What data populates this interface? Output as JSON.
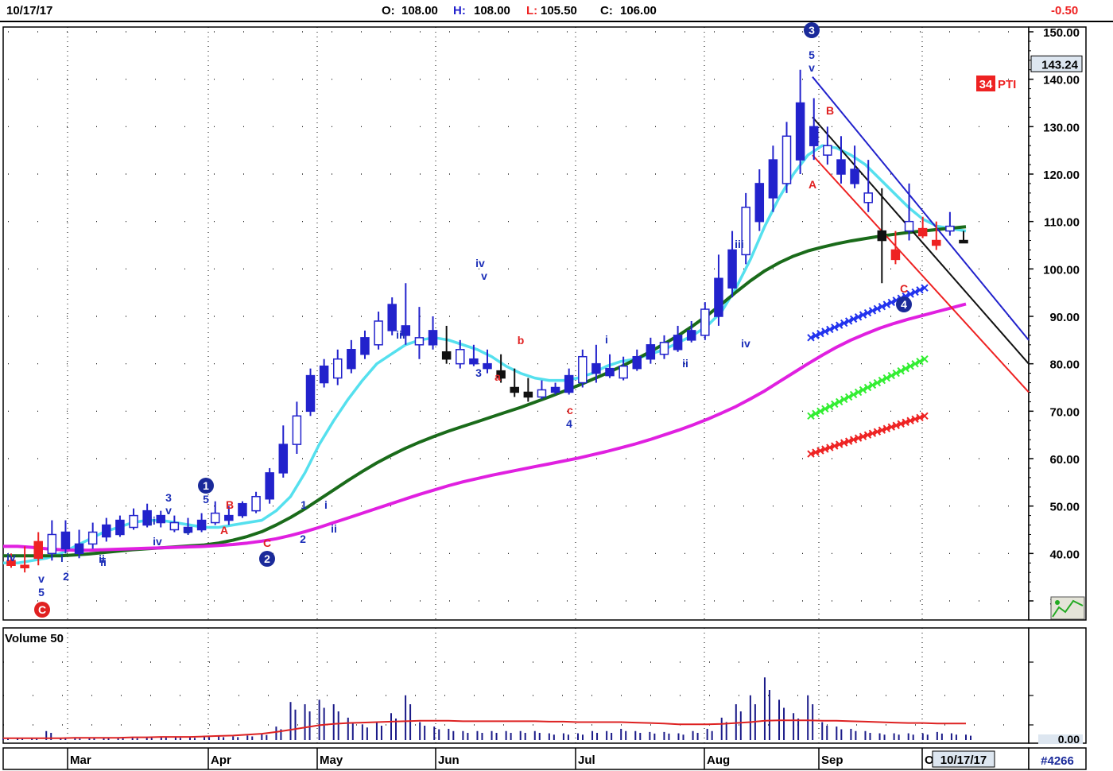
{
  "header": {
    "date": "10/17/17",
    "open_label": "O:",
    "open": "108.00",
    "high_label": "H:",
    "high": "108.00",
    "low_label": "L:",
    "low": "105.50",
    "close_label": "C:",
    "close": "106.00",
    "change": "-0.50"
  },
  "price_panel": {
    "current_price": "143.24",
    "indicator_value": "34",
    "indicator_name": "PTI",
    "icon": "chart-config-icon"
  },
  "volume_panel": {
    "label": "Volume 50",
    "axis_value": "0.00"
  },
  "footer": {
    "cursor_date": "10/17/17",
    "chart_id": "#4266"
  },
  "colors": {
    "candle_up": "#2222cc",
    "candle_down": "#111111",
    "candle_red": "#ee2222",
    "ma_cyan": "#55e0ee",
    "ma_green": "#1a6b1a",
    "ma_magenta": "#e020e0",
    "volume_bar": "#1a1a88",
    "volume_avg": "#dd2222",
    "wave_blue": "#1c2fb8",
    "wave_red": "#e02020"
  },
  "chart_data": {
    "type": "candlestick",
    "y_axis": {
      "min": 30,
      "max": 150,
      "ticks": [
        "150.00",
        "140.00",
        "130.00",
        "120.00",
        "110.00",
        "100.00",
        "90.00",
        "80.00",
        "70.00",
        "60.00",
        "50.00",
        "40.00",
        "30.00"
      ]
    },
    "months": [
      "Mar",
      "Apr",
      "May",
      "Jun",
      "Jul",
      "Aug",
      "Sep",
      "O"
    ],
    "candles": [
      [
        40.0,
        38.5,
        37.5,
        37.0,
        "r"
      ],
      [
        41.5,
        37.0,
        37.5,
        36.0,
        "r"
      ],
      [
        44.5,
        39.0,
        42.5,
        37.5,
        "r"
      ],
      [
        47.0,
        40.0,
        44.0,
        38.5,
        "u"
      ],
      [
        47.0,
        41.0,
        44.5,
        40.0,
        "u"
      ],
      [
        45.0,
        40.0,
        42.0,
        39.0,
        "u"
      ],
      [
        46.5,
        42.0,
        44.5,
        41.0,
        "u"
      ],
      [
        47.5,
        43.5,
        46.0,
        42.5,
        "u"
      ],
      [
        48.0,
        44.0,
        47.0,
        43.5,
        "u"
      ],
      [
        49.5,
        45.5,
        48.0,
        45.0,
        "u"
      ],
      [
        50.5,
        46.0,
        49.0,
        45.5,
        "u"
      ],
      [
        49.0,
        46.5,
        48.0,
        45.5,
        "u"
      ],
      [
        48.0,
        45.0,
        46.5,
        44.5,
        "u"
      ],
      [
        47.5,
        44.5,
        45.5,
        44.0,
        "u"
      ],
      [
        48.5,
        45.0,
        47.0,
        44.5,
        "u"
      ],
      [
        51.0,
        46.5,
        48.5,
        46.0,
        "u"
      ],
      [
        50.0,
        47.0,
        48.0,
        46.0,
        "u"
      ],
      [
        51.0,
        48.0,
        50.5,
        47.5,
        "u"
      ],
      [
        53.0,
        49.0,
        52.0,
        48.5,
        "u"
      ],
      [
        58.0,
        51.5,
        57.0,
        50.5,
        "u"
      ],
      [
        67.0,
        57.0,
        63.0,
        56.0,
        "u"
      ],
      [
        72.0,
        63.0,
        69.0,
        61.0,
        "u"
      ],
      [
        79.0,
        70.0,
        77.5,
        69.0,
        "u"
      ],
      [
        81.0,
        76.0,
        79.5,
        75.0,
        "u"
      ],
      [
        83.0,
        77.0,
        81.0,
        75.5,
        "u"
      ],
      [
        85.0,
        79.0,
        83.0,
        78.0,
        "u"
      ],
      [
        87.0,
        82.0,
        85.5,
        81.0,
        "u"
      ],
      [
        91.0,
        84.0,
        89.0,
        83.0,
        "u"
      ],
      [
        94.0,
        87.0,
        92.5,
        86.0,
        "u"
      ],
      [
        97.0,
        86.0,
        88.0,
        84.0,
        "u"
      ],
      [
        92.0,
        84.0,
        85.5,
        81.0,
        "u"
      ],
      [
        90.0,
        84.0,
        87.0,
        83.0,
        "u"
      ],
      [
        88.0,
        81.0,
        82.5,
        80.0,
        "d"
      ],
      [
        85.0,
        80.0,
        83.0,
        79.0,
        "u"
      ],
      [
        84.0,
        80.0,
        81.0,
        79.5,
        "u"
      ],
      [
        83.0,
        79.0,
        80.0,
        78.0,
        "u"
      ],
      [
        82.0,
        77.0,
        78.5,
        76.0,
        "d"
      ],
      [
        79.0,
        74.0,
        75.0,
        73.0,
        "d"
      ],
      [
        77.0,
        73.0,
        74.0,
        72.0,
        "d"
      ],
      [
        76.5,
        73.0,
        74.5,
        72.5,
        "u"
      ],
      [
        76.0,
        74.0,
        75.0,
        73.5,
        "u"
      ],
      [
        79.0,
        74.0,
        77.5,
        73.5,
        "u"
      ],
      [
        83.0,
        76.0,
        81.5,
        75.0,
        "u"
      ],
      [
        84.0,
        78.0,
        80.0,
        76.0,
        "u"
      ],
      [
        82.0,
        77.5,
        79.0,
        77.0,
        "u"
      ],
      [
        81.5,
        77.0,
        79.5,
        76.5,
        "u"
      ],
      [
        83.0,
        79.0,
        81.5,
        78.5,
        "u"
      ],
      [
        85.5,
        81.0,
        84.0,
        80.0,
        "u"
      ],
      [
        86.0,
        82.0,
        84.5,
        81.0,
        "u"
      ],
      [
        88.0,
        83.0,
        86.0,
        82.5,
        "u"
      ],
      [
        89.0,
        85.0,
        87.0,
        84.5,
        "u"
      ],
      [
        93.0,
        86.0,
        91.5,
        85.0,
        "u"
      ],
      [
        103.0,
        90.0,
        98.0,
        88.0,
        "u"
      ],
      [
        108.0,
        96.0,
        104.0,
        94.0,
        "u"
      ],
      [
        116.0,
        103.0,
        113.0,
        101.0,
        "u"
      ],
      [
        121.0,
        110.0,
        118.0,
        108.0,
        "u"
      ],
      [
        126.0,
        115.0,
        123.0,
        112.0,
        "u"
      ],
      [
        131.0,
        118.0,
        128.0,
        116.0,
        "u"
      ],
      [
        142.0,
        123.0,
        135.0,
        120.0,
        "u"
      ],
      [
        136.0,
        126.0,
        130.0,
        123.0,
        "u"
      ],
      [
        130.0,
        124.0,
        126.0,
        122.0,
        "u"
      ],
      [
        128.0,
        120.0,
        123.0,
        118.0,
        "u"
      ],
      [
        126.0,
        118.0,
        121.0,
        117.0,
        "u"
      ],
      [
        123.0,
        114.0,
        116.0,
        112.0,
        "u"
      ],
      [
        117.0,
        106.0,
        108.0,
        97.0,
        "d"
      ],
      [
        108.0,
        102.0,
        104.0,
        101.0,
        "r"
      ],
      [
        118.0,
        108.0,
        110.0,
        106.0,
        "u"
      ],
      [
        111.0,
        107.0,
        108.5,
        106.5,
        "r"
      ],
      [
        110.0,
        105.0,
        106.0,
        104.0,
        "r"
      ],
      [
        112.0,
        108.0,
        109.0,
        107.0,
        "u"
      ],
      [
        108.0,
        105.5,
        106.0,
        105.5,
        "d"
      ]
    ],
    "moving_averages": [
      {
        "name": "ma-cyan",
        "values": [
          38,
          38,
          38.5,
          39,
          40,
          41.5,
          43,
          44.5,
          45.5,
          46.5,
          47,
          47,
          46.5,
          46,
          45.5,
          45.5,
          46,
          46.5,
          47,
          49,
          52,
          57,
          63,
          68,
          72.5,
          76.5,
          80,
          82,
          84,
          85,
          85.5,
          85,
          84,
          83,
          81.5,
          79.5,
          78,
          77,
          76.5,
          76.5,
          77,
          78,
          79.5,
          80.5,
          81,
          82,
          83,
          84.5,
          86,
          88,
          91,
          96,
          102,
          109,
          115,
          120,
          124,
          126,
          125.5,
          124,
          122,
          119,
          116,
          113,
          110.5,
          109,
          108.5,
          108
        ]
      },
      {
        "name": "ma-green",
        "values": [
          39.5,
          39.5,
          39.5,
          39.5,
          39.5,
          39.7,
          39.9,
          40.2,
          40.5,
          40.8,
          41,
          41.2,
          41.4,
          41.6,
          41.8,
          42.2,
          42.8,
          43.6,
          44.6,
          46,
          47.6,
          49.4,
          51.4,
          53.4,
          55.4,
          57.3,
          59.1,
          60.7,
          62.2,
          63.5,
          64.7,
          65.8,
          66.8,
          67.8,
          68.8,
          69.8,
          70.8,
          71.9,
          73,
          74.2,
          75.4,
          76.7,
          78,
          79.4,
          80.9,
          82.5,
          84.2,
          86,
          88,
          90.2,
          92.6,
          95.1,
          97.5,
          99.6,
          101.3,
          102.7,
          103.8,
          104.6,
          105.3,
          105.9,
          106.4,
          106.9,
          107.3,
          107.7,
          108,
          108.3,
          108.6,
          108.9
        ]
      },
      {
        "name": "ma-magenta",
        "values": [
          41.5,
          41.5,
          41.3,
          41,
          40.8,
          40.7,
          40.7,
          40.8,
          40.9,
          41,
          41.1,
          41.2,
          41.3,
          41.4,
          41.5,
          41.7,
          41.9,
          42.2,
          42.6,
          43.1,
          43.8,
          44.6,
          45.5,
          46.5,
          47.5,
          48.5,
          49.5,
          50.5,
          51.5,
          52.5,
          53.4,
          54.3,
          55.1,
          55.8,
          56.5,
          57.1,
          57.7,
          58.3,
          58.9,
          59.5,
          60.1,
          60.8,
          61.5,
          62.3,
          63.1,
          64,
          65,
          66,
          67.1,
          68.3,
          69.6,
          71,
          72.6,
          74.3,
          76.2,
          78.1,
          80,
          81.8,
          83.5,
          85,
          86.3,
          87.5,
          88.5,
          89.4,
          90.2,
          91,
          91.8,
          92.6
        ]
      }
    ],
    "channel_lines": [
      {
        "name": "upper-channel",
        "color": "#2222cc",
        "from": [
          140.5,
          "Aug-end"
        ],
        "to": [
          85,
          "right-edge"
        ]
      },
      {
        "name": "mid-channel",
        "color": "#111111",
        "from": [
          132,
          "Aug-end"
        ],
        "to": [
          80,
          "right-edge"
        ]
      },
      {
        "name": "lower-channel",
        "color": "#ee2222",
        "from": [
          124,
          "Aug-end"
        ],
        "to": [
          74,
          "right-edge"
        ]
      }
    ],
    "target_lines": [
      {
        "name": "blue-target",
        "color": "#2233ee",
        "from": 85.5,
        "to": 96
      },
      {
        "name": "green-target",
        "color": "#33ee33",
        "from": 69,
        "to": 81
      },
      {
        "name": "red-target",
        "color": "#ee2222",
        "from": 61,
        "to": 69
      }
    ],
    "wave_labels": [
      {
        "t": "iv",
        "c": "b"
      },
      {
        "t": "ii",
        "c": "b"
      },
      {
        "t": "v",
        "c": "b"
      },
      {
        "t": "5",
        "c": "b"
      },
      {
        "t": "i",
        "c": "b"
      },
      {
        "t": "2",
        "c": "b"
      },
      {
        "t": "ii",
        "c": "b"
      },
      {
        "t": "iii",
        "c": "b"
      },
      {
        "t": "iv",
        "c": "b"
      },
      {
        "t": "3",
        "c": "b"
      },
      {
        "t": "v",
        "c": "b"
      },
      {
        "t": "4",
        "c": "b"
      },
      {
        "t": "5",
        "c": "b"
      },
      {
        "t": "A",
        "c": "r"
      },
      {
        "t": "B",
        "c": "r"
      },
      {
        "t": "C",
        "c": "r"
      },
      {
        "t": "1",
        "c": "b"
      },
      {
        "t": "2",
        "c": "b"
      },
      {
        "t": "i",
        "c": "b"
      },
      {
        "t": "ii",
        "c": "b"
      },
      {
        "t": "iii",
        "c": "b"
      },
      {
        "t": "iv",
        "c": "b"
      },
      {
        "t": "3",
        "c": "b"
      },
      {
        "t": "v",
        "c": "b"
      },
      {
        "t": "a",
        "c": "r"
      },
      {
        "t": "b",
        "c": "r"
      },
      {
        "t": "c",
        "c": "r"
      },
      {
        "t": "4",
        "c": "b"
      },
      {
        "t": "i",
        "c": "b"
      },
      {
        "t": "ii",
        "c": "b"
      },
      {
        "t": "iii",
        "c": "b"
      },
      {
        "t": "iv",
        "c": "b"
      },
      {
        "t": "5",
        "c": "b"
      },
      {
        "t": "v",
        "c": "b"
      },
      {
        "t": "A",
        "c": "r"
      },
      {
        "t": "B",
        "c": "r"
      },
      {
        "t": "C",
        "c": "r"
      }
    ],
    "circle_labels": [
      {
        "t": "C",
        "c": "r"
      },
      {
        "t": "1",
        "c": "b"
      },
      {
        "t": "2",
        "c": "b"
      },
      {
        "t": "3",
        "c": "b"
      },
      {
        "t": "4",
        "c": "b"
      }
    ],
    "volume": {
      "values": [
        0.3,
        0.3,
        0.3,
        2,
        0.4,
        0.4,
        0.5,
        0.5,
        0.5,
        0.5,
        0.6,
        0.8,
        0.6,
        0.6,
        0.8,
        0.8,
        0.8,
        1,
        1.4,
        3,
        8.5,
        8,
        9,
        8,
        5,
        3.5,
        4,
        6,
        10,
        4,
        3,
        2.5,
        2,
        2,
        2,
        2,
        2,
        2,
        1.5,
        1.5,
        1.5,
        2,
        2,
        2.5,
        2,
        1.8,
        1.8,
        1.5,
        2,
        2.5,
        5,
        8,
        10,
        14,
        9,
        6,
        10,
        4,
        3,
        2.5,
        2,
        1.5,
        1.5,
        1.5,
        1.5,
        1.8,
        1.5,
        1.2
      ],
      "average": [
        0.4,
        0.4,
        0.4,
        0.4,
        0.4,
        0.5,
        0.5,
        0.5,
        0.5,
        0.6,
        0.6,
        0.7,
        0.7,
        0.7,
        0.8,
        0.9,
        1,
        1.2,
        1.4,
        1.8,
        2.3,
        2.8,
        3.3,
        3.6,
        3.8,
        3.9,
        4,
        4.1,
        4.2,
        4.3,
        4.3,
        4.3,
        4.2,
        4.2,
        4.2,
        4.2,
        4.2,
        4.2,
        4.1,
        4.1,
        4,
        4,
        4,
        4,
        3.9,
        3.8,
        3.7,
        3.5,
        3.5,
        3.5,
        3.6,
        3.8,
        4,
        4.3,
        4.4,
        4.4,
        4.4,
        4.3,
        4.3,
        4.2,
        4.1,
        4,
        3.9,
        3.8,
        3.8,
        3.7,
        3.7,
        3.7
      ],
      "max": 24
    }
  }
}
